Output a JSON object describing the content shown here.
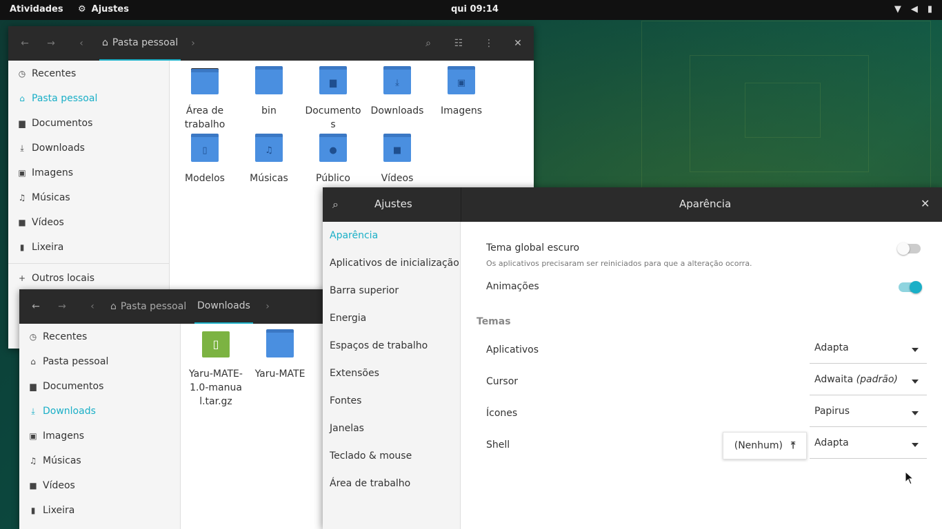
{
  "topbar": {
    "activities": "Atividades",
    "app_name": "Ajustes",
    "clock": "qui 09:14"
  },
  "fm1": {
    "path": {
      "home": "Pasta pessoal"
    },
    "sidebar": [
      "Recentes",
      "Pasta pessoal",
      "Documentos",
      "Downloads",
      "Imagens",
      "Músicas",
      "Vídeos",
      "Lixeira",
      "Outros locais"
    ],
    "files": [
      "Área de trabalho",
      "bin",
      "Documento s",
      "Downloads",
      "Imagens",
      "Modelos",
      "Músicas",
      "Público",
      "Vídeos"
    ]
  },
  "fm2": {
    "path": {
      "home": "Pasta pessoal",
      "current": "Downloads"
    },
    "sidebar": [
      "Recentes",
      "Pasta pessoal",
      "Documentos",
      "Downloads",
      "Imagens",
      "Músicas",
      "Vídeos",
      "Lixeira"
    ],
    "files": [
      "Yaru-MATE-1.0-manual.tar.gz",
      "Yaru-MATE"
    ]
  },
  "tweaks": {
    "title": "Ajustes",
    "page_title": "Aparência",
    "nav": [
      "Aparência",
      "Aplicativos de inicialização",
      "Barra superior",
      "Energia",
      "Espaços de trabalho",
      "Extensões",
      "Fontes",
      "Janelas",
      "Teclado & mouse",
      "Área de trabalho"
    ],
    "dark_theme": {
      "label": "Tema global escuro",
      "note": "Os aplicativos precisaram ser reiniciados para que a alteração ocorra.",
      "on": false
    },
    "animations": {
      "label": "Animações",
      "on": true
    },
    "themes_header": "Temas",
    "rows": [
      {
        "label": "Aplicativos",
        "value": "Adapta"
      },
      {
        "label": "Cursor",
        "value": "Adwaita",
        "value_suffix": "(padrão)"
      },
      {
        "label": "Ícones",
        "value": "Papirus"
      },
      {
        "label": "Shell",
        "value": "Adapta"
      }
    ],
    "shell_popup": "(Nenhum)"
  },
  "colors": {
    "accent": "#1aafc7",
    "headerbar": "#2b2b2b",
    "folder": "#4a8fe0"
  }
}
